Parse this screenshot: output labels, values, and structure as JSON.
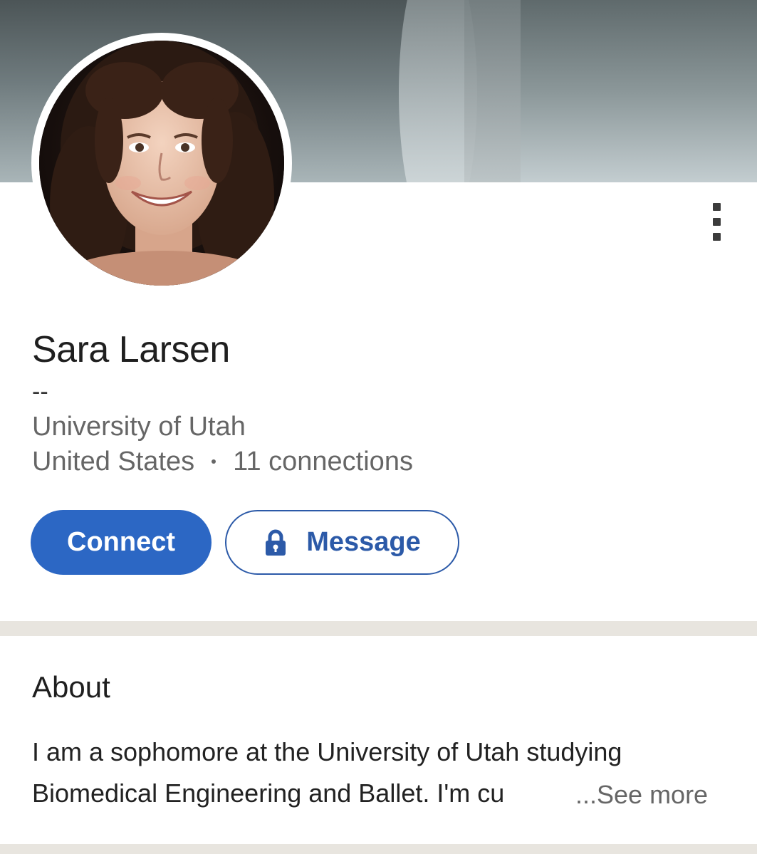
{
  "profile": {
    "name": "Sara Larsen",
    "headline": "--",
    "education": "University of Utah",
    "location": "United States",
    "connections": "11 connections"
  },
  "actions": {
    "connect_label": "Connect",
    "message_label": "Message"
  },
  "about": {
    "title": "About",
    "line1": "I am a sophomore at the University of Utah studying",
    "line2": "Biomedical Engineering and Ballet. I'm cu",
    "see_more": "...See more"
  },
  "icons": {
    "more": "more-vertical-icon",
    "lock": "lock-icon"
  },
  "colors": {
    "primary": "#2c67c4",
    "primary_outline": "#2c5aa8",
    "divider": "#e8e5df"
  }
}
